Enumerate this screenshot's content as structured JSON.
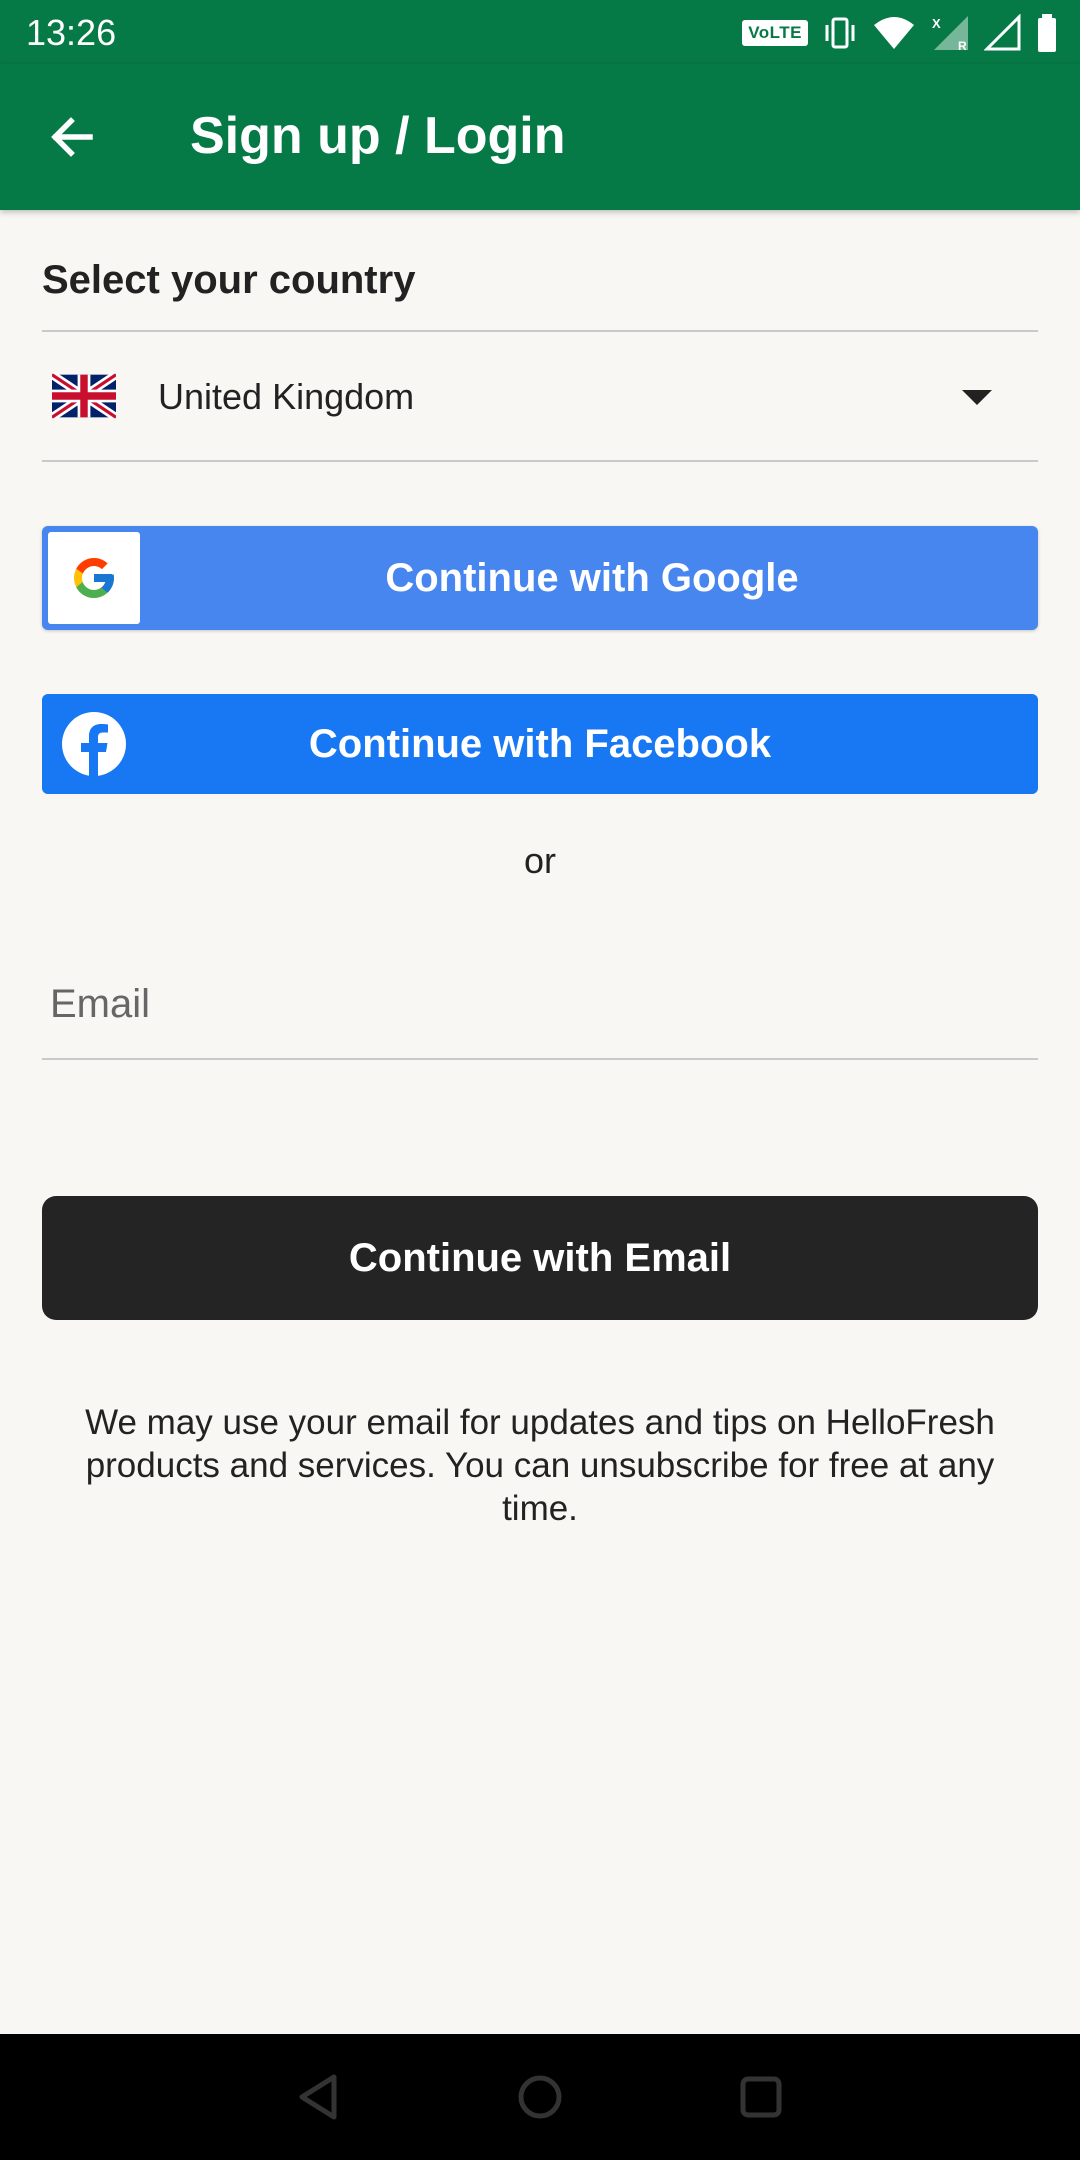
{
  "status_bar": {
    "time": "13:26",
    "volte": "VoLTE",
    "icons": [
      "vibrate-icon",
      "wifi-icon",
      "signal-roaming-icon",
      "signal-icon",
      "battery-icon"
    ]
  },
  "app_bar": {
    "title": "Sign up / Login",
    "back_icon": "arrow-left-icon",
    "background": "#067a46"
  },
  "country": {
    "label": "Select your country",
    "selected": "United Kingdom",
    "flag_icon": "uk-flag-icon"
  },
  "social": {
    "google_label": "Continue with Google",
    "google_color": "#4785ef",
    "facebook_label": "Continue with Facebook",
    "facebook_color": "#1877f2"
  },
  "separator": "or",
  "email": {
    "placeholder": "Email",
    "value": "",
    "button_label": "Continue with Email",
    "button_color": "#242424"
  },
  "disclaimer": "We may use your email for updates and tips on HelloFresh products and services. You can unsubscribe for free at any time.",
  "nav_bar": {
    "icons": [
      "back-triangle-icon",
      "home-circle-icon",
      "recents-square-icon"
    ]
  }
}
